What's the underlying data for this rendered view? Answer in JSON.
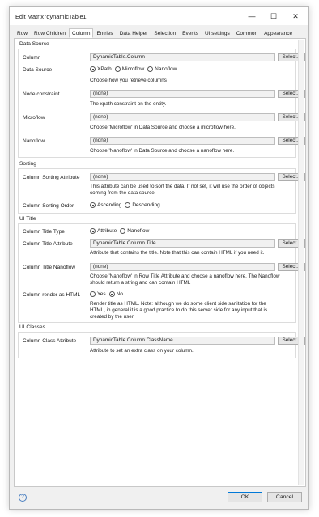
{
  "window": {
    "title": "Edit Matrix 'dynamicTable1'"
  },
  "tabs": [
    {
      "label": "Row"
    },
    {
      "label": "Row Children"
    },
    {
      "label": "Column"
    },
    {
      "label": "Entries"
    },
    {
      "label": "Data Helper"
    },
    {
      "label": "Selection"
    },
    {
      "label": "Events"
    },
    {
      "label": "UI settings"
    },
    {
      "label": "Common"
    },
    {
      "label": "Appearance"
    }
  ],
  "select_label": "Select...",
  "data_source": {
    "title": "Data Source",
    "column": {
      "label": "Column",
      "value": "DynamicTable.Column"
    },
    "source": {
      "label": "Data Source",
      "options": [
        "XPath",
        "Microflow",
        "Nanoflow"
      ],
      "selected": "XPath",
      "help": "Choose how you retrieve columns"
    },
    "node_constraint": {
      "label": "Node constraint",
      "value": "(none)",
      "help": "The xpath constraint on the entity."
    },
    "microflow": {
      "label": "Microflow",
      "value": "(none)",
      "help": "Choose 'Microflow' in Data Source and choose a microflow here."
    },
    "nanoflow": {
      "label": "Nanoflow",
      "value": "(none)",
      "help": "Choose 'Nanoflow' in Data Source and choose a nanoflow here."
    }
  },
  "sorting": {
    "title": "Sorting",
    "attribute": {
      "label": "Column Sorting Attribute",
      "value": "(none)",
      "help1": "This attribute can be used to sort the data. If not set, it will use the order of objects",
      "help2": "coming from the data source"
    },
    "order": {
      "label": "Column Sorting Order",
      "options": [
        "Ascending",
        "Descending"
      ],
      "selected": "Ascending"
    }
  },
  "ui_title": {
    "title": "UI Title",
    "type": {
      "label": "Column Title Type",
      "options": [
        "Attribute",
        "Nanoflow"
      ],
      "selected": "Attribute"
    },
    "attribute": {
      "label": "Column Title Attribute",
      "value": "DynamicTable.Column.Title",
      "help": "Attribute that contains the title. Note that this can contain HTML if you need it."
    },
    "nanoflow": {
      "label": "Column Title Nanoflow",
      "value": "(none)",
      "help1": "Choose 'Nanoflow' in Row Title Attribute and choose a nanoflow here. The Nanoflow",
      "help2": "should return a string and can contain HTML"
    },
    "render_html": {
      "label": "Column render as HTML",
      "options": [
        "Yes",
        "No"
      ],
      "selected": "No",
      "help1": "Render title as HTML. Note: although we do some client side sanitation for the",
      "help2": "HTML, in general it is a good practice to do this server side for any input that is",
      "help3": "created by the user."
    }
  },
  "ui_classes": {
    "title": "UI Classes",
    "class_attribute": {
      "label": "Column Class Attribute",
      "value": "DynamicTable.Column.ClassName",
      "help": "Attribute to set an extra class on your column."
    }
  },
  "footer": {
    "ok_label": "OK",
    "cancel_label": "Cancel",
    "help_glyph": "?"
  }
}
